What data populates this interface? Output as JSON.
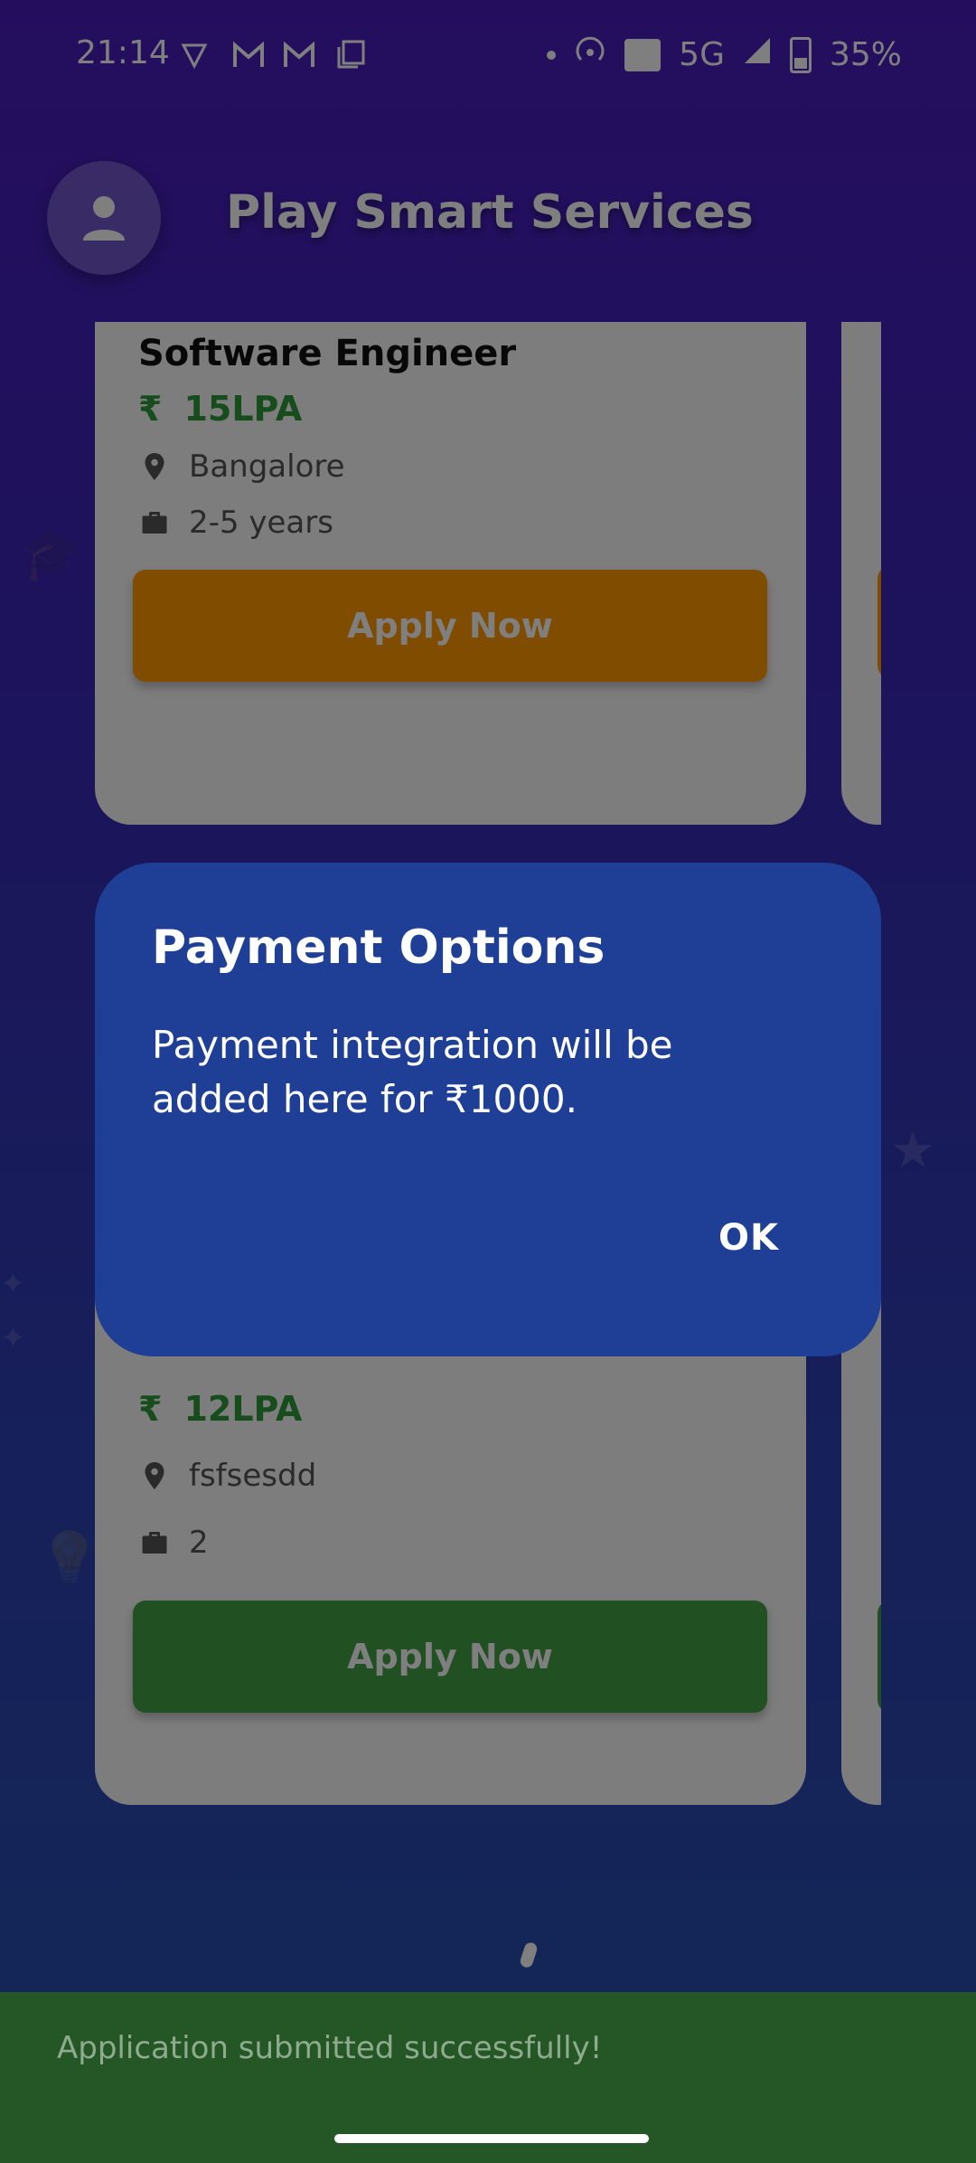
{
  "status_bar": {
    "time": "21:14",
    "network": "5G",
    "battery": "35%"
  },
  "header": {
    "title": "Play Smart Services"
  },
  "jobs": [
    {
      "title": "Software Engineer",
      "salary": "15LPA",
      "location": "Bangalore",
      "experience": "2-5 years",
      "apply_label": "Apply Now",
      "button_color": "#ff9800"
    },
    {
      "salary": "12LPA",
      "location": "fsfsesdd",
      "experience": "2",
      "apply_label": "Apply Now",
      "button_color": "#43a047"
    }
  ],
  "dialog": {
    "title": "Payment Options",
    "body": "Payment integration will be added here for ₹1000.",
    "ok_label": "OK"
  },
  "snackbar": {
    "message": "Application submitted successfully!"
  },
  "currency_symbol": "₹",
  "colors": {
    "salary_green": "#2e9a3a",
    "dialog_bg": "#1f3f96",
    "snackbar_bg": "#255626"
  }
}
